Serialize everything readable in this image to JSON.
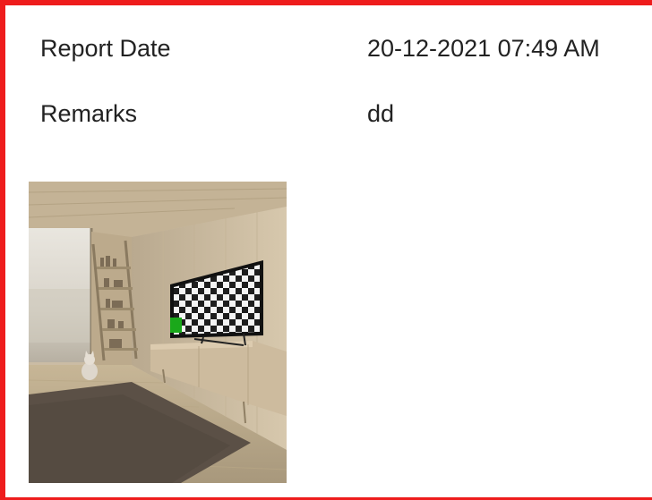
{
  "report": {
    "date_label": "Report Date",
    "date_value": "20-12-2021 07:49 AM",
    "remarks_label": "Remarks",
    "remarks_value": "dd"
  },
  "attachment": {
    "kind": "photo",
    "subject": "living-room-with-tv-test-pattern"
  },
  "colors": {
    "border": "#ee1c1c",
    "text": "#222222",
    "background": "#ffffff",
    "tv_marker": "#1aa81a"
  }
}
